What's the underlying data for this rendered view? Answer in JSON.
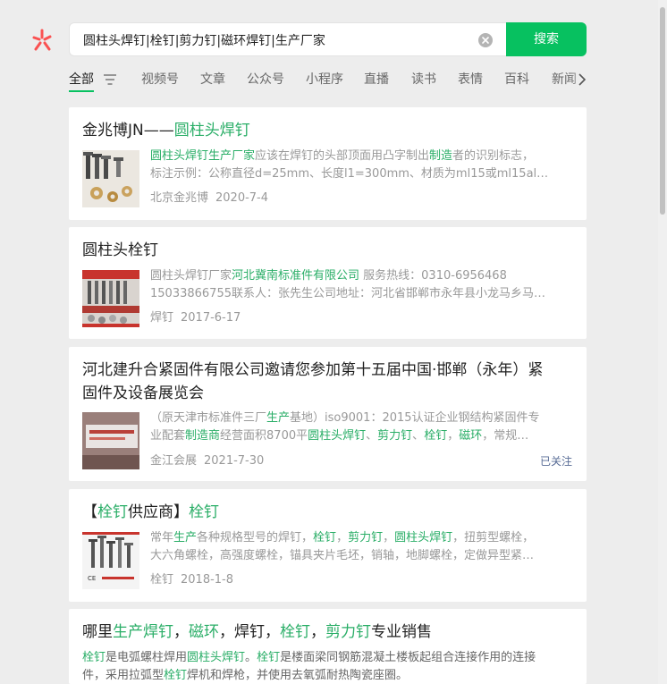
{
  "search": {
    "query": "圆柱头焊钉|栓钉|剪力钉|磁环焊钉|生产厂家",
    "button_label": "搜索"
  },
  "tabs": [
    "全部",
    "视频号",
    "文章",
    "公众号",
    "小程序",
    "直播",
    "读书",
    "表情",
    "百科",
    "新闻"
  ],
  "results": [
    {
      "title": [
        "金兆博JN——",
        "圆柱头焊钉"
      ],
      "snippet_lines": [
        [
          "圆柱头焊钉生产厂家",
          "应该在焊钉的头部顶面用凸字制出",
          "制造",
          "者的识别标志，"
        ],
        [
          "标注示例：公称直径d=25mm、长度l1=300mm、材质为ml15或ml15al…"
        ]
      ],
      "source": "北京金兆博",
      "date": "2020-7-4"
    },
    {
      "title": [
        "圆柱头栓钉"
      ],
      "snippet_lines": [
        [
          "圆柱头焊钉厂家",
          "河北冀南标准件有限公司",
          " 服务热线：0310-6956468"
        ],
        [
          "15033866755联系人：张先生公司地址：河北省邯郸市永年县小龙马乡马…"
        ]
      ],
      "source": "焊钉",
      "date": "2017-6-17"
    },
    {
      "title_lines": [
        "河北建升合紧固件有限公司邀请您参加第十五届中国·邯郸（永年）紧",
        "固件及设备展览会"
      ],
      "snippet_lines": [
        [
          "（原天津市标准件三厂",
          "生产",
          "基地）iso9001：2015认证企业钢结构紧固件专"
        ],
        [
          "业配套",
          "制造商",
          "经营面积8700平",
          "圆柱头焊钉",
          "、",
          "剪力钉",
          "、",
          "栓钉",
          "，",
          "磁环",
          "，常规…"
        ]
      ],
      "source": "金江会展",
      "date": "2021-7-30",
      "followed_label": "已关注"
    },
    {
      "title": [
        "【",
        "栓钉",
        "供应商】",
        "栓钉"
      ],
      "snippet_lines": [
        [
          "常年",
          "生产",
          "各种规格型号的焊钉，",
          "栓钉",
          "，",
          "剪力钉",
          "，",
          "圆柱头焊钉",
          "，扭剪型螺栓，"
        ],
        [
          "大六角螺栓，高强度螺栓，锚具夹片毛坯，销轴，地脚螺栓，定做异型紧…"
        ]
      ],
      "source": "栓钉",
      "date": "2018-1-8"
    },
    {
      "title": [
        "哪里",
        "生产焊钉",
        "，",
        "磁环",
        "，焊钉，",
        "栓钉",
        "，",
        "剪力钉",
        "专业销售"
      ],
      "snippet_lines": [
        [
          "栓钉",
          "是电弧螺柱焊用",
          "圆柱头焊钉",
          "。",
          "栓钉",
          "是楼面梁同钢筋混凝土楼板起组合连接作用的连接"
        ],
        [
          "件，采用拉弧型",
          "栓钉",
          "焊机和焊枪，并使用去氧弧耐热陶瓷座圈。"
        ]
      ]
    }
  ],
  "colors": {
    "accent": "#07c160",
    "highlight": "#2aae67",
    "followed": "#576b95"
  }
}
